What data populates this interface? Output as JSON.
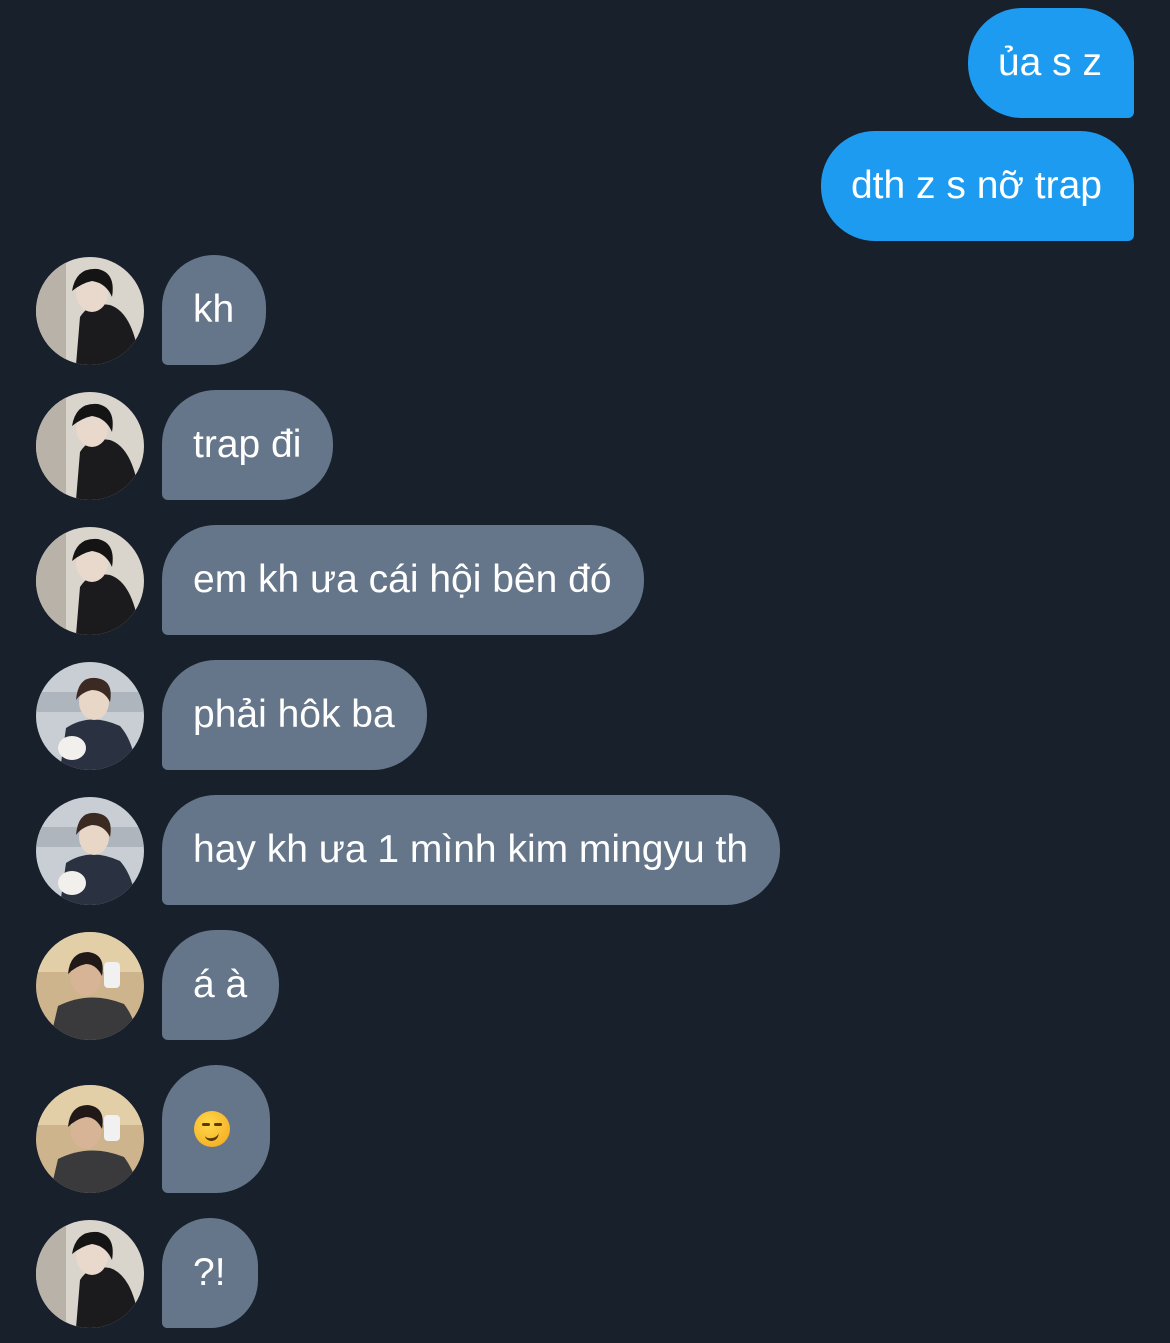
{
  "colors": {
    "background": "#17202b",
    "outgoing_bubble": "#1d9bf0",
    "incoming_bubble": "#65768a",
    "text": "#ffffff"
  },
  "messages": [
    {
      "direction": "outgoing",
      "text": "ủa s z"
    },
    {
      "direction": "outgoing",
      "text": "dth z s nỡ trap"
    },
    {
      "direction": "incoming",
      "sender_avatar": "avatar-a",
      "text": "kh"
    },
    {
      "direction": "incoming",
      "sender_avatar": "avatar-a",
      "text": "trap đi"
    },
    {
      "direction": "incoming",
      "sender_avatar": "avatar-a",
      "text": "em kh ưa cái hội bên đó"
    },
    {
      "direction": "incoming",
      "sender_avatar": "avatar-b",
      "text": "phải hôk ba"
    },
    {
      "direction": "incoming",
      "sender_avatar": "avatar-b",
      "text": "hay kh ưa 1 mình kim mingyu th"
    },
    {
      "direction": "incoming",
      "sender_avatar": "avatar-c",
      "text": "á à"
    },
    {
      "direction": "incoming",
      "sender_avatar": "avatar-c",
      "emoji": "smirking-face-emoji"
    },
    {
      "direction": "incoming",
      "sender_avatar": "avatar-a",
      "text": "?!"
    }
  ]
}
